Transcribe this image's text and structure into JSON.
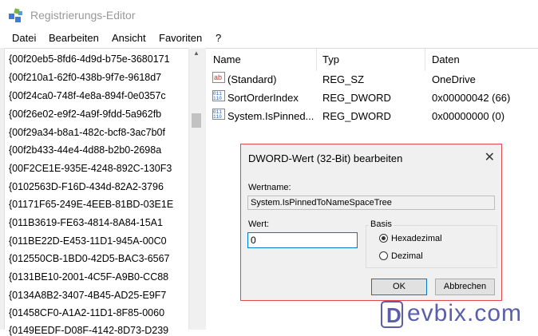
{
  "window": {
    "title": "Registrierungs-Editor"
  },
  "menu": [
    "Datei",
    "Bearbeiten",
    "Ansicht",
    "Favoriten",
    "?"
  ],
  "tree": {
    "items": [
      "{00f20eb5-8fd6-4d9d-b75e-3680171",
      "{00f210a1-62f0-438b-9f7e-9618d7",
      "{00f24ca0-748f-4e8a-894f-0e0357c",
      "{00f26e02-e9f2-4a9f-9fdd-5a962fb",
      "{00f29a34-b8a1-482c-bcf8-3ac7b0f",
      "{00f2b433-44e4-4d88-b2b0-2698a",
      "{00F2CE1E-935E-4248-892C-130F3",
      "{0102563D-F16D-434d-82A2-3796",
      "{01171F65-249E-4EEB-81BD-03E1E",
      "{011B3619-FE63-4814-8A84-15A1",
      "{011BE22D-E453-11D1-945A-00C0",
      "{012550CB-1BD0-42D5-BAC3-6567",
      "{0131BE10-2001-4C5F-A9B0-CC88",
      "{0134A8B2-3407-4B45-AD25-E9F7",
      "{01458CF0-A1A2-11D1-8F85-0060",
      "{0149EEDF-D08F-4142-8D73-D239"
    ]
  },
  "list": {
    "headers": {
      "name": "Name",
      "type": "Typ",
      "data": "Daten"
    },
    "rows": [
      {
        "icon": "string-value-icon",
        "name": "(Standard)",
        "type": "REG_SZ",
        "data": "OneDrive"
      },
      {
        "icon": "binary-value-icon",
        "name": "SortOrderIndex",
        "type": "REG_DWORD",
        "data": "0x00000042 (66)"
      },
      {
        "icon": "binary-value-icon",
        "name": "System.IsPinned...",
        "type": "REG_DWORD",
        "data": "0x00000000 (0)"
      }
    ]
  },
  "dialog": {
    "title": "DWORD-Wert (32-Bit) bearbeiten",
    "close": "✕",
    "name_label": "Wertname:",
    "name_value": "System.IsPinnedToNameSpaceTree",
    "value_label": "Wert:",
    "value": "0",
    "base_label": "Basis",
    "hex_label": "Hexadezimal",
    "dec_label": "Dezimal",
    "selected_base": "Hexadezimal",
    "ok": "OK",
    "cancel": "Abbrechen"
  },
  "watermark": {
    "text": "evbix.com"
  },
  "colors": {
    "dialog_border": "#e0484a",
    "focus_blue": "#0078d7",
    "watermark": "#5a5fa8"
  }
}
